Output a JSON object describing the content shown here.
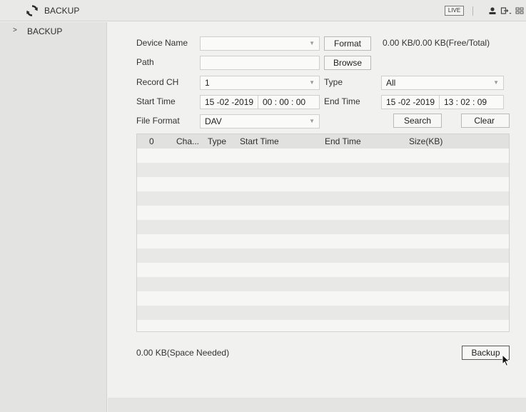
{
  "titlebar": {
    "title": "BACKUP",
    "live_label": "LIVE",
    "icons": [
      "refresh-icon",
      "user-icon",
      "logout-icon",
      "grid-icon"
    ]
  },
  "sidebar": {
    "items": [
      {
        "label": "BACKUP",
        "chevron": ">"
      }
    ]
  },
  "form": {
    "device_name_label": "Device Name",
    "device_name_value": "",
    "format_button": "Format",
    "capacity_text": "0.00 KB/0.00 KB(Free/Total)",
    "path_label": "Path",
    "path_value": "",
    "browse_button": "Browse",
    "record_ch_label": "Record CH",
    "record_ch_value": "1",
    "type_label": "Type",
    "type_value": "All",
    "start_time_label": "Start Time",
    "start_date": "15 -02 -2019",
    "start_time": "00 : 00 : 00",
    "end_time_label": "End Time",
    "end_date": "15 -02 -2019",
    "end_time": "13 : 02 : 09",
    "file_format_label": "File Format",
    "file_format_value": "DAV",
    "search_button": "Search",
    "clear_button": "Clear"
  },
  "table": {
    "columns": [
      "0",
      "Cha...",
      "Type",
      "Start Time",
      "End Time",
      "Size(KB)"
    ],
    "rows": []
  },
  "space_needed": "0.00 KB(Space Needed)",
  "backup_button": "Backup",
  "colors": {
    "background": "#f1f1ef",
    "sidebar": "#e3e3e1",
    "table_header": "#e1e1df",
    "row_alt": "#e8e8e6"
  }
}
